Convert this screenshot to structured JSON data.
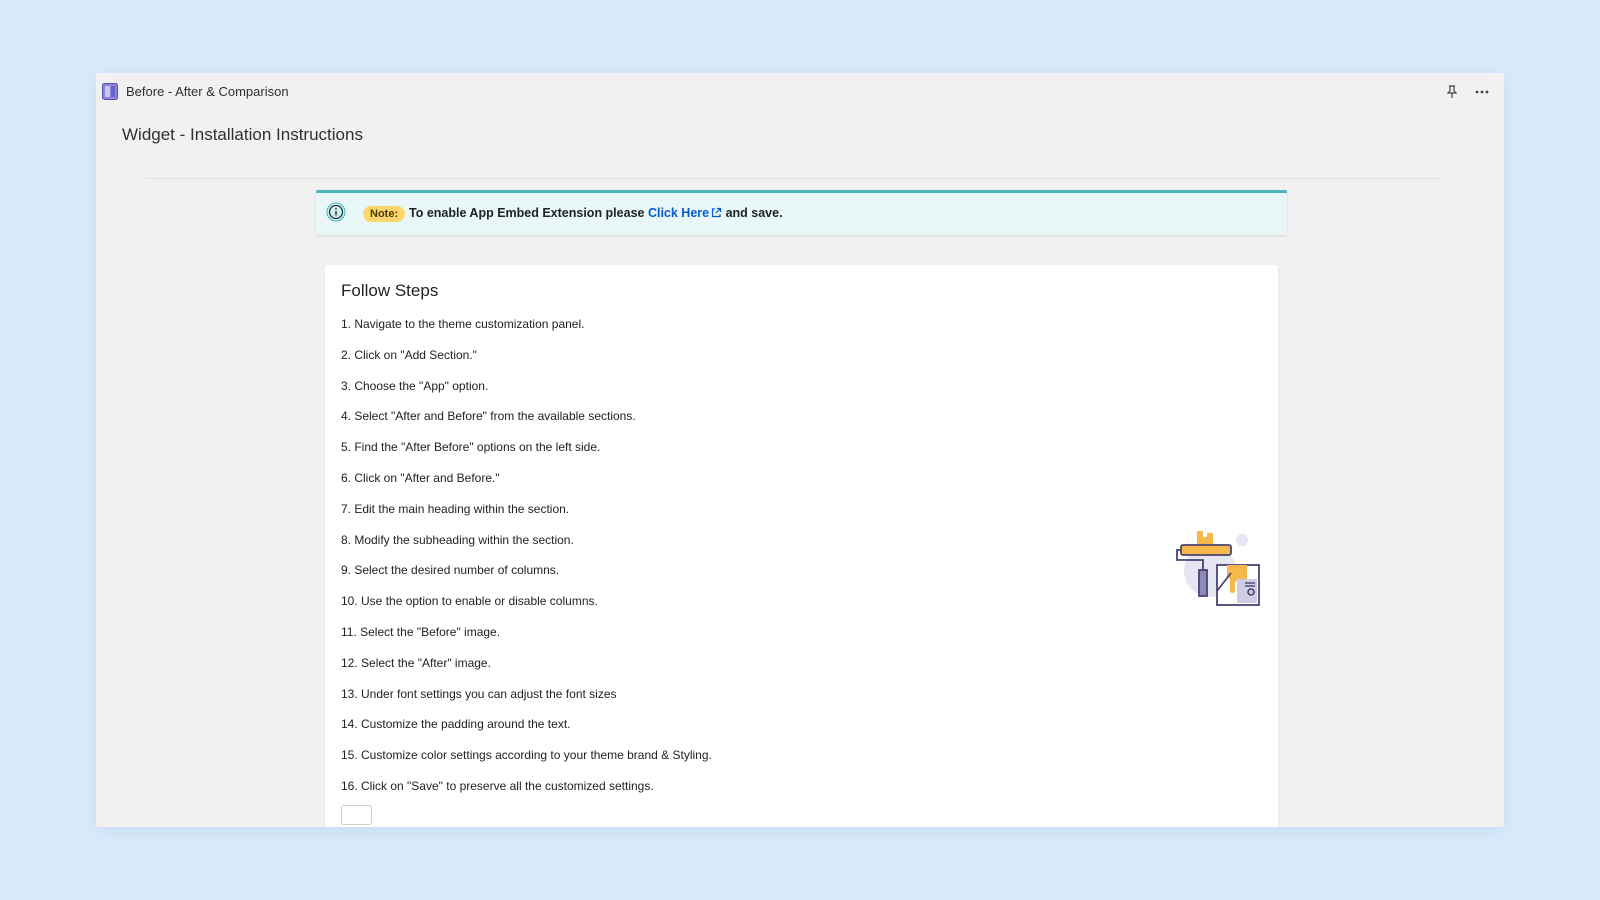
{
  "app": {
    "title": "Before - After & Comparison",
    "icons": {
      "app": "book-icon",
      "pin": "pin-icon",
      "more": "more-horizontal-icon"
    }
  },
  "page": {
    "title": "Widget - Installation Instructions"
  },
  "note": {
    "badge": "Note:",
    "text_before": "To enable App Embed Extension please ",
    "link_label": "Click Here",
    "text_after": " and save.",
    "icon": "info-icon",
    "accent_color": "#4db3bd"
  },
  "steps_card": {
    "title": "Follow Steps",
    "steps": [
      "1. Navigate to the theme customization panel.",
      "2. Click on \"Add Section.\"",
      "3. Choose the \"App\" option.",
      "4. Select \"After and Before\" from the available sections.",
      "5. Find the \"After Before\" options on the left side.",
      "6. Click on \"After and Before.\"",
      "7. Edit the main heading within the section.",
      "8. Modify the subheading within the section.",
      "9. Select the desired number of columns.",
      "10. Use the option to enable or disable columns.",
      "11. Select the \"Before\" image.",
      "12. Select the \"After\" image.",
      "13. Under font settings you can adjust the font sizes",
      "14. Customize the padding around the text.",
      "15. Customize color settings according to your theme brand & Styling.",
      "16. Click on \"Save\" to preserve all the customized settings."
    ],
    "illustration": "paint-roller-illustration"
  }
}
